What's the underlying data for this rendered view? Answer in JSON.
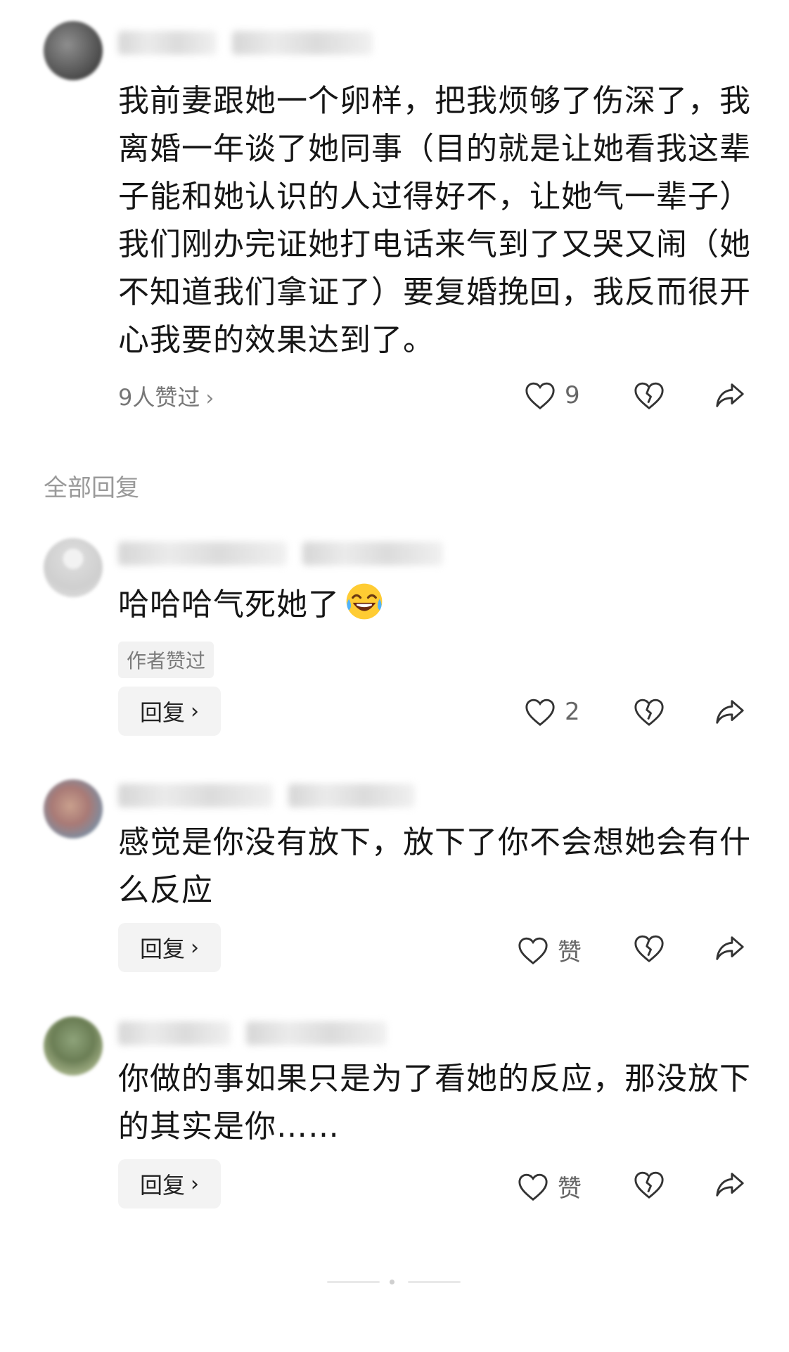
{
  "main_comment": {
    "text": "我前妻跟她一个卵样，把我烦够了伤深了，我离婚一年谈了她同事（目的就是让她看我这辈子能和她认识的人过得好不，让她气一辈子）我们刚办完证她打电话来气到了又哭又闹（她不知道我们拿证了）要复婚挽回，我反而很开心我要的效果达到了。",
    "likers_label": "9人赞过",
    "like_count": "9"
  },
  "section_title": "全部回复",
  "replies": [
    {
      "text": "哈哈哈气死她了",
      "emoji": "laughing-crying-emoji",
      "badge": "作者赞过",
      "reply_label": "回复",
      "like_count": "2"
    },
    {
      "text": "感觉是你没有放下，放下了你不会想她会有什么反应",
      "reply_label": "回复",
      "like_count": "赞"
    },
    {
      "text": "你做的事如果只是为了看她的反应，那没放下的其实是你……",
      "reply_label": "回复",
      "like_count": "赞"
    }
  ],
  "icons": {
    "like": "heart-outline-icon",
    "dislike": "broken-heart-icon",
    "share": "share-arrow-icon",
    "chevron": "chevron-right-icon"
  },
  "colors": {
    "text": "#161616",
    "muted": "#777777",
    "icon": "#333333",
    "button_bg": "#f3f3f3"
  }
}
